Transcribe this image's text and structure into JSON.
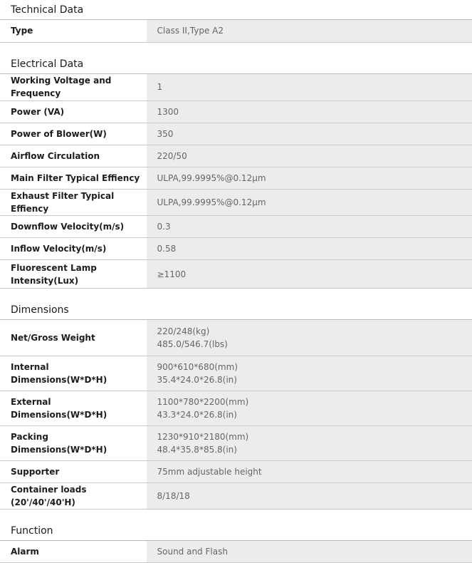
{
  "sections": [
    {
      "title": "Technical Data",
      "rows": [
        {
          "label": "Type",
          "value": [
            "Class II,Type A2"
          ]
        }
      ]
    },
    {
      "title": "Electrical Data",
      "rows": [
        {
          "label": "Working Voltage and Frequency",
          "value": [
            "1"
          ]
        },
        {
          "label": "Power (VA)",
          "value": [
            "1300"
          ]
        },
        {
          "label": "Power of Blower(W)",
          "value": [
            "350"
          ]
        },
        {
          "label": "Airflow Circulation",
          "value": [
            "220/50"
          ]
        },
        {
          "label": "Main Filter Typical Effiency",
          "value": [
            "ULPA,99.9995%@0.12μm"
          ]
        },
        {
          "label": "Exhaust Filter Typical Effiency",
          "value": [
            "ULPA,99.9995%@0.12μm"
          ]
        },
        {
          "label": "Downflow Velocity(m/s)",
          "value": [
            "0.3"
          ]
        },
        {
          "label": "Inflow Velocity(m/s)",
          "value": [
            "0.58"
          ]
        },
        {
          "label": "Fluorescent Lamp Intensity(Lux)",
          "value": [
            "≥1100"
          ]
        }
      ]
    },
    {
      "title": "Dimensions",
      "rows": [
        {
          "label": "Net/Gross Weight",
          "value": [
            "220/248(kg)",
            "485.0/546.7(lbs)"
          ]
        },
        {
          "label": "Internal Dimensions(W*D*H)",
          "value": [
            "900*610*680(mm)",
            "35.4*24.0*26.8(in)"
          ]
        },
        {
          "label": "External Dimensions(W*D*H)",
          "value": [
            "1100*780*2200(mm)",
            "43.3*24.0*26.8(in)"
          ]
        },
        {
          "label": "Packing Dimensions(W*D*H)",
          "value": [
            "1230*910*2180(mm)",
            "48.4*35.8*85.8(in)"
          ]
        },
        {
          "label": "Supporter",
          "value": [
            "75mm adjustable height"
          ]
        },
        {
          "label": "Container loads (20'/40'/40'H)",
          "value": [
            "8/18/18"
          ]
        }
      ]
    },
    {
      "title": "Function",
      "rows": [
        {
          "label": "Alarm",
          "value": [
            "Sound and Flash"
          ]
        }
      ]
    }
  ]
}
